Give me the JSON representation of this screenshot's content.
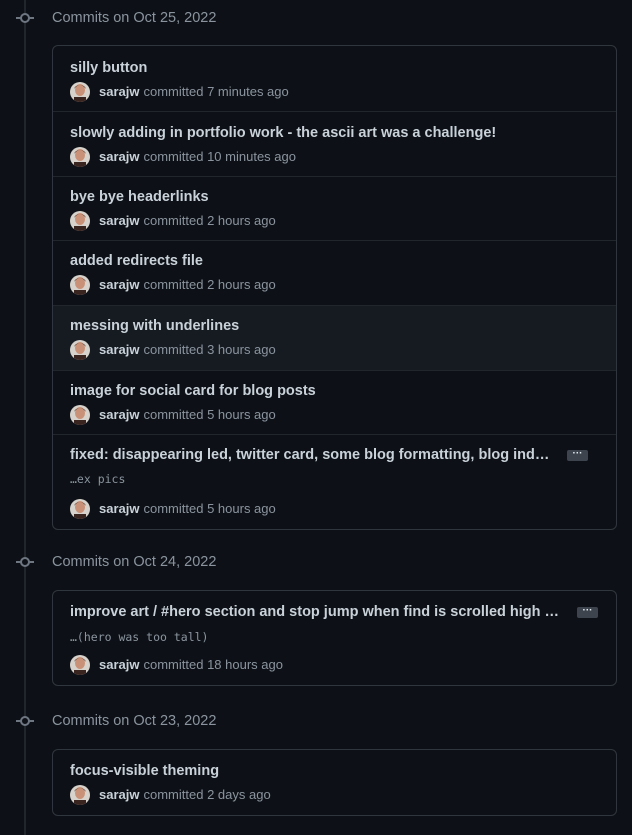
{
  "groups": [
    {
      "title": "Commits on Oct 25, 2022",
      "commits": [
        {
          "message": "silly button",
          "author": "sarajw",
          "action": "committed",
          "time": "7 minutes ago"
        },
        {
          "message": "slowly adding in portfolio work - the ascii art was a challenge!",
          "author": "sarajw",
          "action": "committed",
          "time": "10 minutes ago"
        },
        {
          "message": "bye bye headerlinks",
          "author": "sarajw",
          "action": "committed",
          "time": "2 hours ago"
        },
        {
          "message": "added redirects file",
          "author": "sarajw",
          "action": "committed",
          "time": "2 hours ago"
        },
        {
          "message": "messing with underlines",
          "author": "sarajw",
          "action": "committed",
          "time": "3 hours ago"
        },
        {
          "message": "image for social card for blog posts",
          "author": "sarajw",
          "action": "committed",
          "time": "5 hours ago"
        },
        {
          "message": "fixed: disappearing led, twitter card, some blog formatting, blog ind…",
          "extended": "…ex pics",
          "more": "···",
          "author": "sarajw",
          "action": "committed",
          "time": "5 hours ago"
        }
      ]
    },
    {
      "title": "Commits on Oct 24, 2022",
      "commits": [
        {
          "message": "improve art / #hero section and stop jump when find is scrolled high …",
          "extended": "…(hero was too tall)",
          "more": "···",
          "author": "sarajw",
          "action": "committed",
          "time": "18 hours ago"
        }
      ]
    },
    {
      "title": "Commits on Oct 23, 2022",
      "commits": [
        {
          "message": "focus-visible theming",
          "author": "sarajw",
          "action": "committed",
          "time": "2 days ago"
        }
      ]
    }
  ],
  "colors": {
    "background": "#0d1117",
    "border": "#30363d",
    "text": "#c9d1d9",
    "muted": "#8b949e",
    "highlight": "#161b22"
  },
  "icons": {
    "group": "git-commit-icon",
    "avatar": "user-avatar",
    "more": "ellipsis-icon"
  }
}
